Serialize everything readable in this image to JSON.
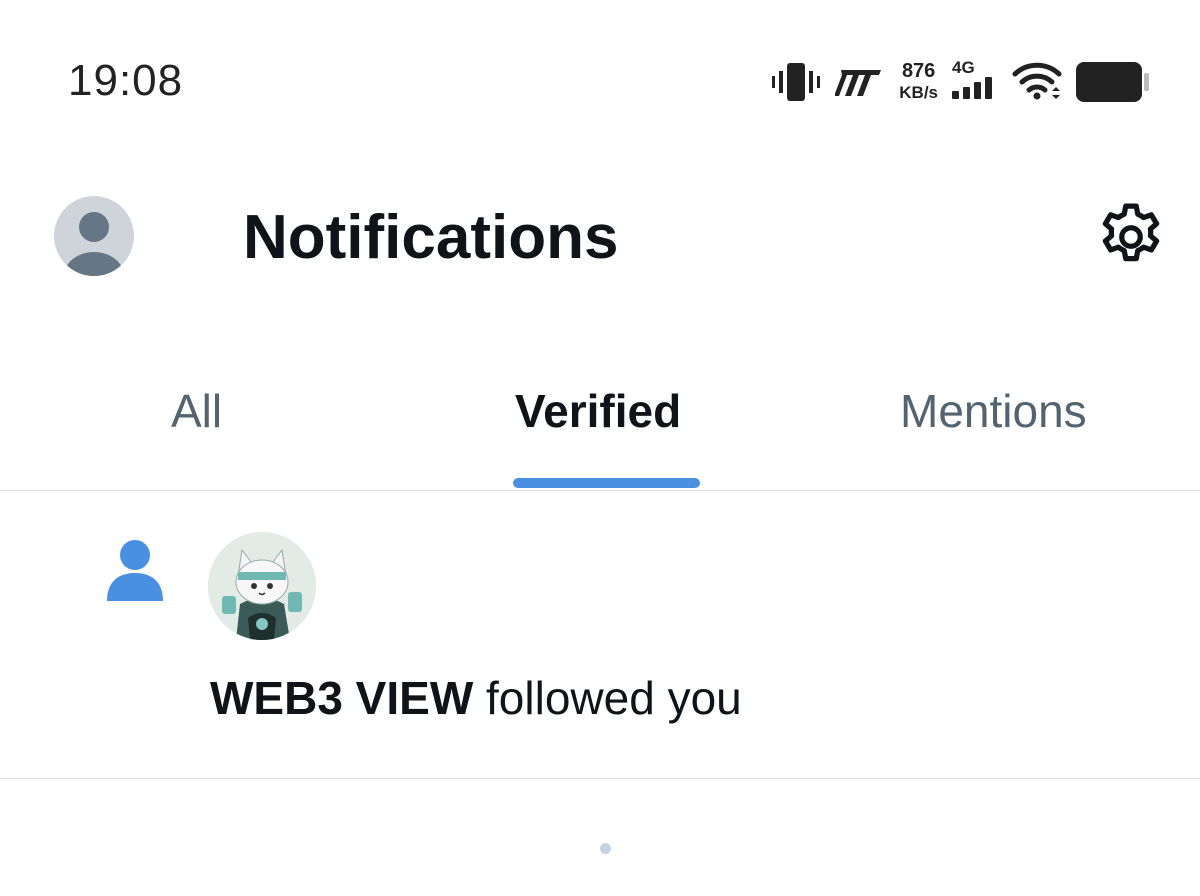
{
  "status_bar": {
    "time": "19:08",
    "net_speed_value": "876",
    "net_speed_unit": "KB/s",
    "network_type": "4G",
    "icons": [
      "vibrate-icon",
      "carrier-logo-icon",
      "signal-icon",
      "wifi-icon",
      "battery-icon"
    ]
  },
  "header": {
    "title": "Notifications",
    "icons": [
      "avatar",
      "gear-icon"
    ]
  },
  "tabs": [
    {
      "label": "All",
      "active": false
    },
    {
      "label": "Verified",
      "active": true
    },
    {
      "label": "Mentions",
      "active": false
    }
  ],
  "notifications": [
    {
      "type_icon": "person-icon",
      "user_name": "WEB3 VIEW",
      "action": "followed you"
    }
  ],
  "colors": {
    "accent": "#4a90e2",
    "text": "#0f1419",
    "muted": "#536471",
    "divider": "#d8dbe0"
  }
}
